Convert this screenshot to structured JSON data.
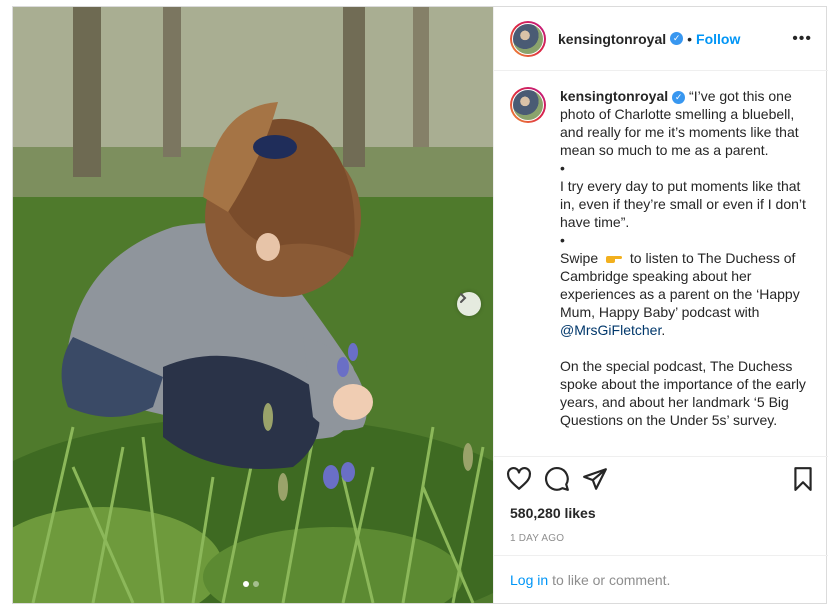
{
  "post": {
    "username": "kensingtonroyal",
    "follow_label": "Follow",
    "separator": "•",
    "more_label": "•••",
    "caption_paragraphs": [
      "“I’ve got this one photo of Charlotte smelling a bluebell, and really for me it’s moments like that mean so much to me as a parent.",
      "•",
      "I try every day to put moments like that in, even if they’re small or even if I don’t have time”.",
      "•"
    ],
    "swipe_word": "Swipe",
    "swipe_rest": "to listen to The Duchess of Cambridge speaking about her experiences as a parent on the ‘Happy Mum, Happy Baby’ podcast with",
    "mention": "@MrsGiFletcher",
    "mention_end": ".",
    "last_paragraph": "On the special podcast, The Duchess spoke about the importance of the early years, and about her landmark ‘5 Big Questions on the Under 5s’ survey.",
    "likes": "580,280 likes",
    "time": "1 DAY AGO",
    "login_link": "Log in",
    "login_rest": "to like or comment."
  },
  "colors": {
    "link_blue": "#0095f6",
    "verified_blue": "#3897f0",
    "muted_text": "#8e8e8e"
  },
  "icons": {
    "like": "heart-icon",
    "comment": "comment-icon",
    "share": "share-icon",
    "save": "bookmark-icon",
    "next": "chevron-right-icon"
  },
  "carousel": {
    "slide_count": 2,
    "active_index": 0
  }
}
